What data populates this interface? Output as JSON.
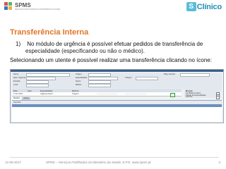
{
  "header": {
    "brand_left": "SPMS",
    "brand_left_sub": "SERVIÇOS PARTILHADOS DO MINISTÉRIO DA SAÚDE",
    "brand_right_box": "S",
    "brand_right_text": "Clínico"
  },
  "slide": {
    "title": "Transferência Interna",
    "point_number": "1)",
    "point_text_line1": "No módulo de urgência é possível efetuar pedidos de transferência de",
    "point_text_line2": "especialidade (especificando ou não o médico).",
    "description": "Selecionando um utente é possível realizar uma transferência clicando no ícone:"
  },
  "app": {
    "labels": {
      "name": "Nome:",
      "episode": "Epis. Urgência:",
      "entry": "Entrada:",
      "origin": "Origem:",
      "local": "Local",
      "speciality": "Especialidade:",
      "sector": "Sector",
      "doctor": "Médico",
      "triage": "Triagem:",
      "prev_diag": "Diag. Anterior:",
      "date": "Data",
      "time": "Hora",
      "specialties": "Especialidades",
      "doctors": "Médicos",
      "favorites": "Favoritos"
    },
    "tabs": [
      "Médicos",
      "Outros"
    ],
    "side": {
      "title": "Mostrar:",
      "options": [
        "Só Médicos Ativos",
        "Passar de Especialidade",
        "Favorito"
      ]
    },
    "grid_date": "17-07-2017",
    "grid_specialty": "Urgência Geral",
    "grid_status": "Triagem"
  },
  "footer": {
    "date": "12-09-2017",
    "text": "SPMS – Serviços Partilhados do Ministério da Saúde, E.P.E. www.spms.pt",
    "page": "3"
  }
}
